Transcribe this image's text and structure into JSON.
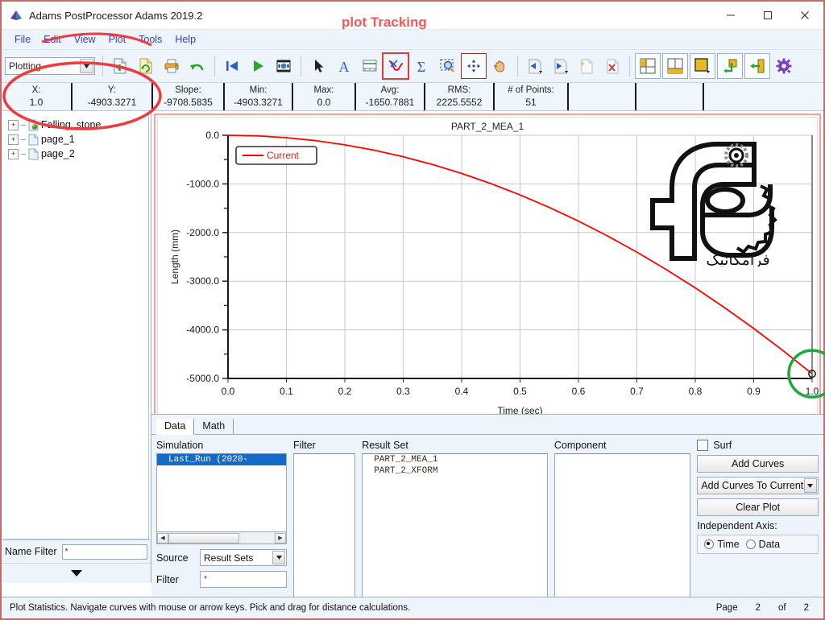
{
  "window": {
    "title": "Adams PostProcessor Adams 2019.2",
    "minimize_label": "minimize",
    "maximize_label": "maximize",
    "close_label": "close"
  },
  "menu": {
    "items": [
      "File",
      "Edit",
      "View",
      "Plot",
      "Tools",
      "Help"
    ]
  },
  "toolbar": {
    "mode_combo_value": "Plotting",
    "buttons": [
      {
        "name": "new-page-icon",
        "tip": "New Page"
      },
      {
        "name": "reload-page-icon",
        "tip": "Reload Page"
      },
      {
        "name": "print-icon",
        "tip": "Print"
      },
      {
        "name": "undo-icon",
        "tip": "Undo"
      },
      {
        "name": "first-frame-icon",
        "tip": "First Frame"
      },
      {
        "name": "play-icon",
        "tip": "Play"
      },
      {
        "name": "record-icon",
        "tip": "Record Animation"
      },
      {
        "name": "select-arrow-icon",
        "tip": "Select"
      },
      {
        "name": "text-icon",
        "tip": "Add Text"
      },
      {
        "name": "axis-icon",
        "tip": "Plot Axis"
      },
      {
        "name": "plot-tracking-icon",
        "tip": "Plot Tracking"
      },
      {
        "name": "statistics-sigma-icon",
        "tip": "Plot Statistics"
      },
      {
        "name": "zoom-icon",
        "tip": "Zoom"
      },
      {
        "name": "fit-icon",
        "tip": "Fit to Window"
      },
      {
        "name": "pan-hand-icon",
        "tip": "Pan"
      },
      {
        "name": "previous-page-icon",
        "tip": "Previous Page"
      },
      {
        "name": "next-page-icon",
        "tip": "Next Page"
      },
      {
        "name": "new-document-icon",
        "tip": "New"
      },
      {
        "name": "delete-document-icon",
        "tip": "Delete"
      },
      {
        "name": "layout-left-icon",
        "tip": "Layout Left"
      },
      {
        "name": "layout-bottom-icon",
        "tip": "Layout Bottom"
      },
      {
        "name": "layout-single-icon",
        "tip": "Single View"
      },
      {
        "name": "swap-icon",
        "tip": "Swap"
      },
      {
        "name": "load-icon",
        "tip": "Load"
      },
      {
        "name": "settings-gear-icon",
        "tip": "Settings"
      }
    ]
  },
  "stats": [
    {
      "label": "X:",
      "value": "1.0"
    },
    {
      "label": "Y:",
      "value": "-4903.3271"
    },
    {
      "label": "Slope:",
      "value": "-9708.5835"
    },
    {
      "label": "Min:",
      "value": "-4903.3271"
    },
    {
      "label": "Max:",
      "value": "0.0"
    },
    {
      "label": "Avg:",
      "value": "-1650.7881"
    },
    {
      "label": "RMS:",
      "value": "2225.5552"
    },
    {
      "label": "# of Points:",
      "value": "51"
    }
  ],
  "tree": {
    "items": [
      {
        "label": "Falling_stone",
        "expander": "+",
        "icon": "model-icon"
      },
      {
        "label": "page_1",
        "expander": "+",
        "icon": "page-icon"
      },
      {
        "label": "page_2",
        "expander": "+",
        "icon": "page-icon"
      }
    ],
    "name_filter_label": "Name Filter",
    "name_filter_value": "*"
  },
  "chart_data": {
    "type": "line",
    "title": "PART_2_MEA_1",
    "xlabel": "Time (sec)",
    "ylabel": "Length (mm)",
    "xlim": [
      0.0,
      1.0
    ],
    "ylim": [
      -5000.0,
      0.0
    ],
    "xticks": [
      "0.0",
      "0.1",
      "0.2",
      "0.3",
      "0.4",
      "0.5",
      "0.6",
      "0.7",
      "0.8",
      "0.9",
      "1.0"
    ],
    "yticks": [
      "-5000.0",
      "-4000.0",
      "-3000.0",
      "-2000.0",
      "-1000.0",
      "0.0"
    ],
    "grid": true,
    "legend_position": "top-left",
    "legend": [
      "Current"
    ],
    "series": [
      {
        "name": "Current",
        "color": "#ff0000",
        "x": [
          0.0,
          0.05,
          0.1,
          0.15,
          0.2,
          0.25,
          0.3,
          0.35,
          0.4,
          0.45,
          0.5,
          0.55,
          0.6,
          0.65,
          0.7,
          0.75,
          0.8,
          0.85,
          0.9,
          0.95,
          1.0
        ],
        "y": [
          0.0,
          -12.3,
          -49.0,
          -110.3,
          -196.1,
          -306.5,
          -441.3,
          -600.7,
          -784.5,
          -992.9,
          -1225.8,
          -1483.2,
          -1765.2,
          -2071.7,
          -2402.6,
          -2758.2,
          -3138.2,
          -3542.8,
          -3971.9,
          -4425.6,
          -4903.3
        ]
      }
    ],
    "marker_point": {
      "x": 1.0,
      "y": -4903.3271,
      "label": "tracking-marker"
    },
    "watermark_text": "فرامکانیک"
  },
  "dock": {
    "tabs": [
      {
        "label": "Data",
        "active": true
      },
      {
        "label": "Math",
        "active": false
      }
    ],
    "simulation": {
      "label": "Simulation",
      "items": [
        {
          "text": "Last_Run        (2020-",
          "selected": true
        }
      ]
    },
    "filter": {
      "label": "Filter",
      "items": []
    },
    "result_set": {
      "label": "Result Set",
      "items": [
        {
          "text": "PART_2_MEA_1",
          "selected": false
        },
        {
          "text": "PART_2_XFORM",
          "selected": false
        }
      ]
    },
    "component": {
      "label": "Component",
      "items": []
    },
    "source_label": "Source",
    "source_value": "Result Sets",
    "filter_label": "Filter",
    "filter_value": "*",
    "surf_label": "Surf",
    "surf_checked": false,
    "add_curves_label": "Add Curves",
    "add_curves_mode": "Add Curves To Current",
    "clear_plot_label": "Clear Plot",
    "independent_axis_label": "Independent Axis:",
    "independent_axis_options": [
      "Time",
      "Data"
    ],
    "independent_axis_selected": "Time"
  },
  "statusbar": {
    "message": "Plot Statistics.  Navigate curves with mouse or arrow keys.  Pick and drag for distance calculations.",
    "page_label": "Page",
    "page_current": "2",
    "page_of": "of",
    "page_total": "2"
  },
  "annotations": {
    "plot_tracking_text": "plot Tracking",
    "highlight_color": "#ee3b3b",
    "marker_circle_color": "#1ea83c"
  }
}
